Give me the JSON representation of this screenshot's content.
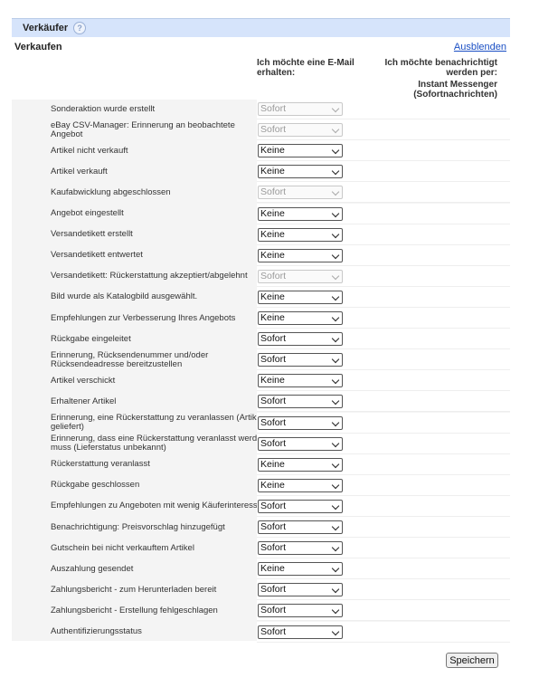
{
  "header": {
    "title": "Verkäufer",
    "help_icon": "question-icon"
  },
  "section": {
    "title": "Verkaufen",
    "hide_link": "Ausblenden"
  },
  "columns": {
    "email": "Ich möchte eine E-Mail erhalten:",
    "notify": "Ich möchte benachrichtigt werden per:",
    "im": "Instant Messenger (Sofortnachrichten)"
  },
  "rows": [
    {
      "label": "Sonderaktion wurde erstellt",
      "value": "Sofort",
      "disabled": true
    },
    {
      "label": "eBay CSV-Manager: Erinnerung an beobachtete Angebot",
      "value": "Sofort",
      "disabled": true
    },
    {
      "label": "Artikel nicht verkauft",
      "value": "Keine",
      "disabled": false
    },
    {
      "label": "Artikel verkauft",
      "value": "Keine",
      "disabled": false
    },
    {
      "label": "Kaufabwicklung abgeschlossen",
      "value": "Sofort",
      "disabled": true
    },
    {
      "label": "Angebot eingestellt",
      "value": "Keine",
      "disabled": false
    },
    {
      "label": "Versandetikett erstellt",
      "value": "Keine",
      "disabled": false
    },
    {
      "label": "Versandetikett entwertet",
      "value": "Keine",
      "disabled": false
    },
    {
      "label": "Versandetikett: Rückerstattung akzeptiert/abgelehnt",
      "value": "Sofort",
      "disabled": true
    },
    {
      "label": "Bild wurde als Katalogbild ausgewählt.",
      "value": "Keine",
      "disabled": false
    },
    {
      "label": "Empfehlungen zur Verbesserung Ihres Angebots",
      "value": "Keine",
      "disabled": false
    },
    {
      "label": "Rückgabe eingeleitet",
      "value": "Sofort",
      "disabled": false
    },
    {
      "label": "Erinnerung, Rücksendenummer und/oder Rücksendeadresse bereitzustellen",
      "value": "Sofort",
      "disabled": false
    },
    {
      "label": "Artikel verschickt",
      "value": "Keine",
      "disabled": false
    },
    {
      "label": "Erhaltener Artikel",
      "value": "Sofort",
      "disabled": false
    },
    {
      "label": "Erinnerung, eine Rückerstattung zu veranlassen (Artikel geliefert)",
      "value": "Sofort",
      "disabled": false
    },
    {
      "label": "Erinnerung, dass eine Rückerstattung veranlasst werden muss (Lieferstatus unbekannt)",
      "value": "Sofort",
      "disabled": false
    },
    {
      "label": "Rückerstattung veranlasst",
      "value": "Keine",
      "disabled": false
    },
    {
      "label": "Rückgabe geschlossen",
      "value": "Keine",
      "disabled": false
    },
    {
      "label": "Empfehlungen zu Angeboten mit wenig Käuferinteresse",
      "value": "Sofort",
      "disabled": false
    },
    {
      "label": "Benachrichtigung: Preisvorschlag hinzugefügt",
      "value": "Sofort",
      "disabled": false
    },
    {
      "label": "Gutschein bei nicht verkauftem Artikel",
      "value": "Sofort",
      "disabled": false
    },
    {
      "label": "Auszahlung gesendet",
      "value": "Keine",
      "disabled": false
    },
    {
      "label": "Zahlungsbericht - zum Herunterladen bereit",
      "value": "Sofort",
      "disabled": false
    },
    {
      "label": "Zahlungsbericht - Erstellung fehlgeschlagen",
      "value": "Sofort",
      "disabled": false
    },
    {
      "label": "Authentifizierungsstatus",
      "value": "Sofort",
      "disabled": false
    }
  ],
  "save_button": "Speichern"
}
